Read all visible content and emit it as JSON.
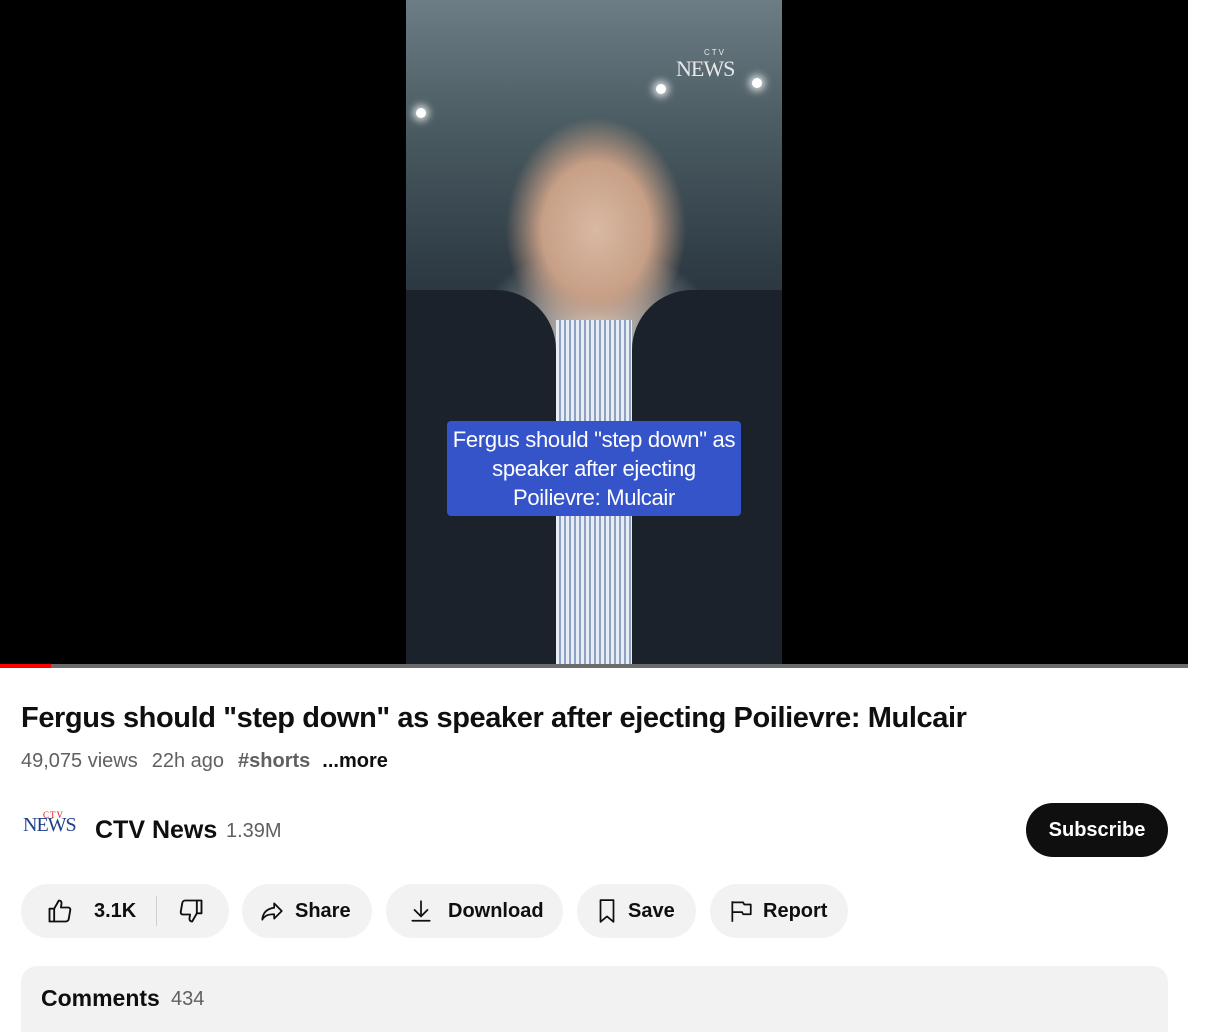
{
  "video": {
    "caption": "Fergus should \"step down\" as speaker after ejecting Poilievre: Mulcair",
    "watermark": "NEWS",
    "watermark_small": "CTV",
    "progress_fraction": 0.043
  },
  "title": "Fergus should \"step down\" as speaker after ejecting Poilievre: Mulcair",
  "meta": {
    "views": "49,075 views",
    "age": "22h ago",
    "hashtag": "#shorts",
    "more": "...more"
  },
  "channel": {
    "logo_text": "NEWS",
    "logo_top": "CTV",
    "name": "CTV News",
    "subscribers": "1.39M",
    "subscribe_label": "Subscribe"
  },
  "actions": {
    "like_count": "3.1K",
    "share_label": "Share",
    "download_label": "Download",
    "save_label": "Save",
    "report_label": "Report"
  },
  "comments": {
    "title": "Comments",
    "count": "434"
  },
  "colors": {
    "accent_red": "#ff0000",
    "caption_blue": "#3554c9",
    "pill_bg": "#f2f2f2"
  }
}
